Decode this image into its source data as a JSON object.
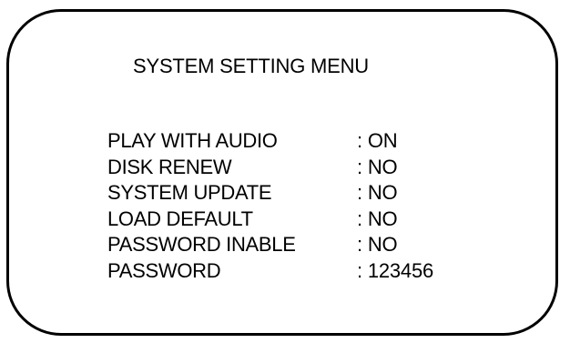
{
  "menu": {
    "title": "SYSTEM SETTING MENU",
    "rows": [
      {
        "label": "PLAY WITH AUDIO",
        "value": ": ON"
      },
      {
        "label": "DISK RENEW",
        "value": ": NO"
      },
      {
        "label": "SYSTEM UPDATE",
        "value": ": NO"
      },
      {
        "label": "LOAD DEFAULT",
        "value": ": NO"
      },
      {
        "label": "PASSWORD INABLE",
        "value": ": NO"
      },
      {
        "label": "PASSWORD",
        "value": ": 123456"
      }
    ]
  }
}
